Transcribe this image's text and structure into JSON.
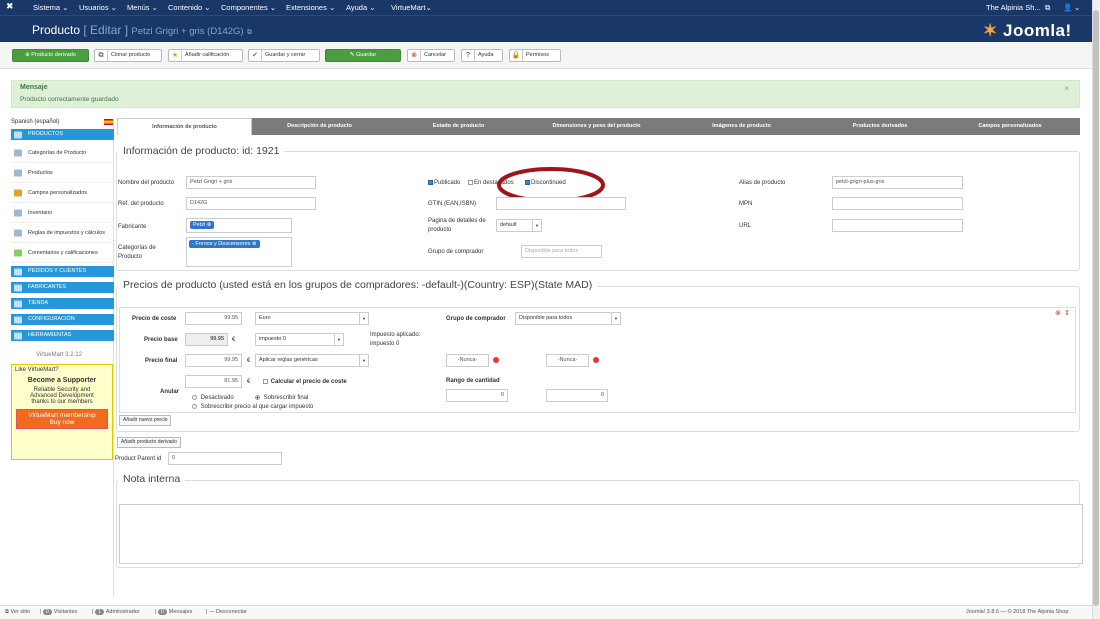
{
  "topnav": {
    "menus": [
      "Sistema ⌄",
      "Usuarios ⌄",
      "Menús ⌄",
      "Contenido ⌄",
      "Componentes ⌄",
      "Extensiones ⌄",
      "Ayuda ⌄",
      "VirtueMart⌄"
    ],
    "site_link": "The Alpinia Sh...",
    "user": "⌄"
  },
  "header": {
    "title": "Producto",
    "edit": "[ Editar ]",
    "product_name": "Petzl Grigri + gris (D142G)",
    "brand": "Joomla!"
  },
  "toolbar": {
    "child_product": "Producto derivado",
    "clone": "Clonar producto",
    "add_rating": "Añadir calificación",
    "save_close": "Guardar y cerrar",
    "save": "Guardar",
    "cancel": "Cancelar",
    "help": "Ayuda",
    "permissions": "Permisos"
  },
  "message": {
    "heading": "Mensaje",
    "body": "Producto correctamente guardado",
    "close": "×"
  },
  "sidebar": {
    "language": "Spanish (español)",
    "productos": "PRODUCTOS",
    "items": [
      "Categorías de Producto",
      "Productos",
      "Campos personalizados",
      "Inventario",
      "Reglas de impuestos y cálculos",
      "Comentarios y calificaciones"
    ],
    "sections": [
      "PEDIDOS Y CLIENTES",
      "FABRICANTES",
      "TIENDA",
      "CONFIGURACIÓN",
      "HERRAMIENTAS"
    ],
    "version": "VirtueMart 3.2.12",
    "promo": {
      "like": "Like VirtueMart?",
      "title": "Become a Supporter",
      "text1": "Reliable Security and",
      "text2": "Advanced Development",
      "text3": "thanks to our members",
      "btn1": "VirtueMart membership",
      "btn2": "Buy now"
    }
  },
  "tabs": [
    "Información de producto",
    "Descripción de producto",
    "Estado de producto",
    "Dimensiones y peso del producto",
    "Imágenes de producto",
    "Productos derivados",
    "Campos personalizados"
  ],
  "info": {
    "legend": "Información de producto: id: 1921",
    "name_label": "Nombre del producto",
    "name_value": "Petzl Grigri + gris",
    "sku_label": "Ref. del producto",
    "sku_value": "D142G",
    "mfr_label": "Fabricante",
    "mfr_value": "Petzl",
    "cat_label1": "Categorías de",
    "cat_label2": "Producto",
    "cat_value": "- Frenos y Descensores",
    "published": "Publicado",
    "featured": "En destacados",
    "discontinued": "Discontinued",
    "gtin_label": "GTIN (EAN,ISBN)",
    "detail_label1": "Pagina de detalles de",
    "detail_label2": "producto",
    "detail_value": "default",
    "group_label": "Grupo de comprador",
    "group_placeholder": "Disponible para todos",
    "alias_label": "Alias de producto",
    "alias_value": "petzl-grigri-plus-gris",
    "mpn_label": "MPN",
    "url_label": "URL"
  },
  "prices": {
    "legend": "Precios de producto (usted está en los grupos de compradores: -default-)(Country: ESP)(State MAD)",
    "cost_label": "Precio de coste",
    "cost_value": "99.95",
    "currency": "Euro",
    "base_label": "Precio base",
    "base_value": "99.95",
    "euro": "€",
    "tax_select": "impuesto 0",
    "tax_applied1": "Impuesto aplicado:",
    "tax_applied2": "impuesto 0",
    "final_label": "Precio final",
    "final_value": "99.95",
    "rules_select": "Aplicar reglas genéricas",
    "override_label": "Anular",
    "override_value": "81.95",
    "calc_cost": "Calcular el precio de coste",
    "opt_disabled": "Desactivado",
    "opt_override_final": "Sobrescribir final",
    "opt_override_pre_tax": "Sobrescribir precio al que cargar impuesto",
    "group_label": "Grupo de comprador",
    "group_value": "Disponible para todos",
    "never1": "-Nunca-",
    "never2": "-Nunca-",
    "qty_label": "Rango de cantidad",
    "qty_from": "0",
    "qty_to": "0",
    "add_price": "Añadir nuevo precio"
  },
  "child": {
    "add_btn": "Añadir producto derivado",
    "parent_label": "Product Parent id",
    "parent_value": "0"
  },
  "note": {
    "legend": "Nota interna"
  },
  "footer": {
    "view_site": "Ver sitio",
    "visitors_count": "0",
    "visitors": "Visitantes",
    "admin_count": "1",
    "admin": "Administrador",
    "msg_count": "0",
    "messages": "Mensajes",
    "logout": "Desconectar",
    "copyright": "Joomla! 3.8.6 — © 2018 The Alpinia Shop"
  },
  "colors": {
    "navbar": "#1a3867",
    "accent": "#2697db",
    "save_green": "#4a9e3f",
    "annotation": "#a01515"
  }
}
